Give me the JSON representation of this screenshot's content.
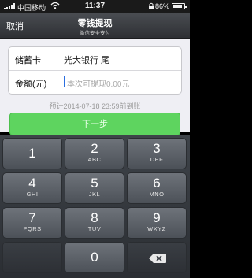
{
  "status_bar": {
    "carrier": "中国移动",
    "time": "11:37",
    "battery": "86%",
    "battery_level": 0.86
  },
  "nav": {
    "cancel_label": "取消",
    "title": "零钱提现",
    "subtitle": "微信安全支付"
  },
  "form": {
    "card_label": "储蓄卡",
    "card_value": "光大银行 尾",
    "amount_label": "金额(元)",
    "amount_placeholder": "本次可提现0.00元",
    "amount_value": ""
  },
  "arrival_note": "预计2014-07-18 23:59前到账",
  "next_button": "下一步",
  "keypad": {
    "keys": [
      {
        "num": "1",
        "letters": ""
      },
      {
        "num": "2",
        "letters": "ABC"
      },
      {
        "num": "3",
        "letters": "DEF"
      },
      {
        "num": "4",
        "letters": "GHI"
      },
      {
        "num": "5",
        "letters": "JKL"
      },
      {
        "num": "6",
        "letters": "MNO"
      },
      {
        "num": "7",
        "letters": "PQRS"
      },
      {
        "num": "8",
        "letters": "TUV"
      },
      {
        "num": "9",
        "letters": "WXYZ"
      },
      {
        "num": "",
        "letters": ""
      },
      {
        "num": "0",
        "letters": ""
      }
    ]
  },
  "colors": {
    "nav_bg": "#3a3d42",
    "next_button": "#5ed45f",
    "page_bg": "#efeff4"
  }
}
